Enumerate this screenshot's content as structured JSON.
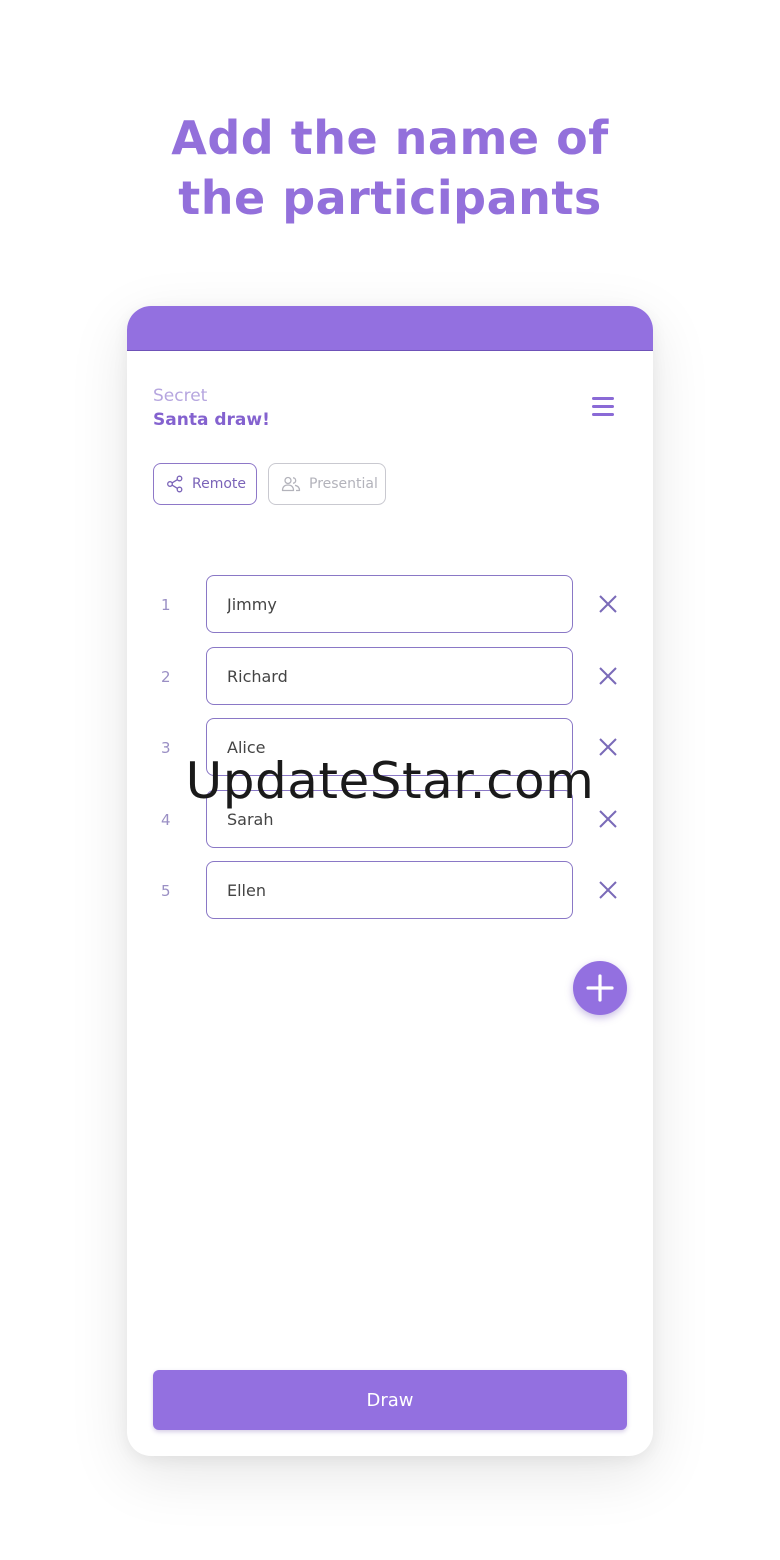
{
  "headline": {
    "line1": "Add the name of",
    "line2": "the participants"
  },
  "app": {
    "subtitle": "Secret",
    "title": "Santa draw!"
  },
  "icons": {
    "menu": "menu-icon",
    "share": "share-icon",
    "people": "people-icon",
    "close": "close-icon",
    "plus": "plus-icon"
  },
  "modes": {
    "remote_label": "Remote",
    "presential_label": "Presential",
    "selected": "Remote"
  },
  "participants": [
    {
      "number": "1",
      "name": "Jimmy"
    },
    {
      "number": "2",
      "name": "Richard"
    },
    {
      "number": "3",
      "name": "Alice"
    },
    {
      "number": "4",
      "name": "Sarah"
    },
    {
      "number": "5",
      "name": "Ellen"
    }
  ],
  "actions": {
    "draw_label": "Draw"
  },
  "watermark": "UpdateStar.com",
  "colors": {
    "accent": "#9370E0",
    "headline": "#9370DB",
    "muted": "#b3b3bb"
  }
}
